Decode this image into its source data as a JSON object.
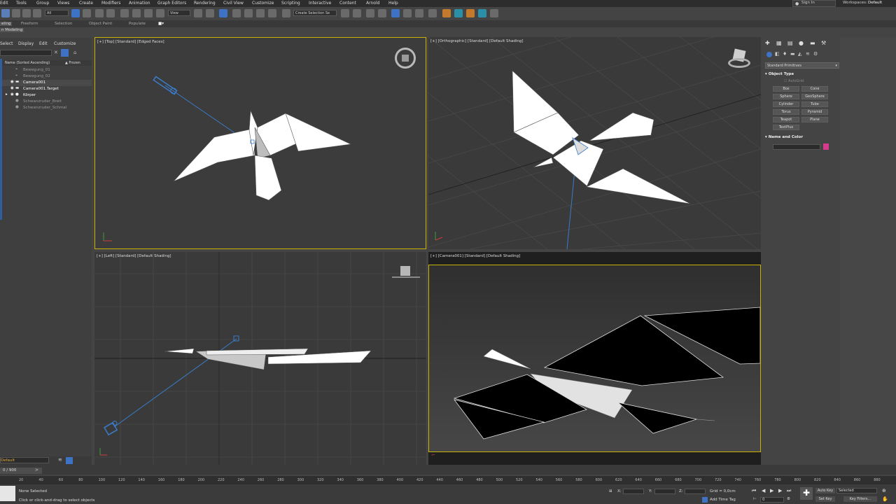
{
  "menu": [
    "Edit",
    "Tools",
    "Group",
    "Views",
    "Create",
    "Modifiers",
    "Animation",
    "Graph Editors",
    "Rendering",
    "Civil View",
    "Customize",
    "Scripting",
    "Interactive",
    "Content",
    "Arnold",
    "Help"
  ],
  "signin": "Sign In",
  "workspace": {
    "label": "Workspaces:",
    "value": "Default"
  },
  "toolbar": {
    "filter": "All",
    "refcoord": "View",
    "selset": "Create Selection Se"
  },
  "ribbon": {
    "tabs": [
      "eling",
      "Freeform",
      "Selection",
      "Object Paint",
      "Populate"
    ],
    "sub": "n Modeling"
  },
  "explorer": {
    "menu": [
      "Select",
      "Display",
      "Edit",
      "Customize"
    ],
    "col_name": "Name (Sorted Ascending)",
    "col_frozen": "▲ Frozen",
    "rows": [
      "Bewegung_01",
      "Bewegung_02",
      "Camera001",
      "Camera001.Target",
      "Körper",
      "Schwanzruder_Breit",
      "Schwanzruder_Schmal"
    ]
  },
  "viewports": {
    "top": "[+] [Top] [Standard] [Edged Faces]",
    "ortho": "[+] [Orthographic] [Standard] [Default Shading]",
    "left": "[+] [Left] [Standard] [Default Shading]",
    "camera": "[+] [Camera001] [Standard] [Default Shading]"
  },
  "cmdpanel": {
    "category": "Standard Primitives",
    "object_type": "Object Type",
    "autogrid": "AutoGrid",
    "buttons": [
      "Box",
      "Cone",
      "Sphere",
      "GeoSphere",
      "Cylinder",
      "Tube",
      "Torus",
      "Pyramid",
      "Teapot",
      "Plane",
      "TextPlus"
    ],
    "name_color": "Name and Color",
    "color": "#d63a8c"
  },
  "layer": "Default",
  "time": {
    "frame": "0 / 900",
    "ticks": [
      "20",
      "40",
      "60",
      "80",
      "100",
      "120",
      "140",
      "160",
      "180",
      "200",
      "220",
      "240",
      "260",
      "280",
      "300",
      "320",
      "340",
      "360",
      "380",
      "400",
      "420",
      "440",
      "460",
      "480",
      "500",
      "520",
      "540",
      "560",
      "580",
      "600",
      "620",
      "640",
      "660",
      "680",
      "700",
      "720",
      "740",
      "760",
      "780",
      "800",
      "820",
      "840",
      "860",
      "880"
    ]
  },
  "status": {
    "selection": "None Selected",
    "prompt": "Click or click-and-drag to select objects",
    "x": "X:",
    "y": "Y:",
    "z": "Z:",
    "grid": "Grid = 0,0cm",
    "add_time_tag": "Add Time Tag",
    "auto_key": "Auto Key",
    "selected": "Selected",
    "set_key": "Set Key",
    "key_filters": "Key Filters...",
    "frame_value": "0"
  },
  "colors": {
    "viewport_bg": "#373737",
    "active_border": "#c8b400",
    "camera_line": "#3a7cc8"
  }
}
